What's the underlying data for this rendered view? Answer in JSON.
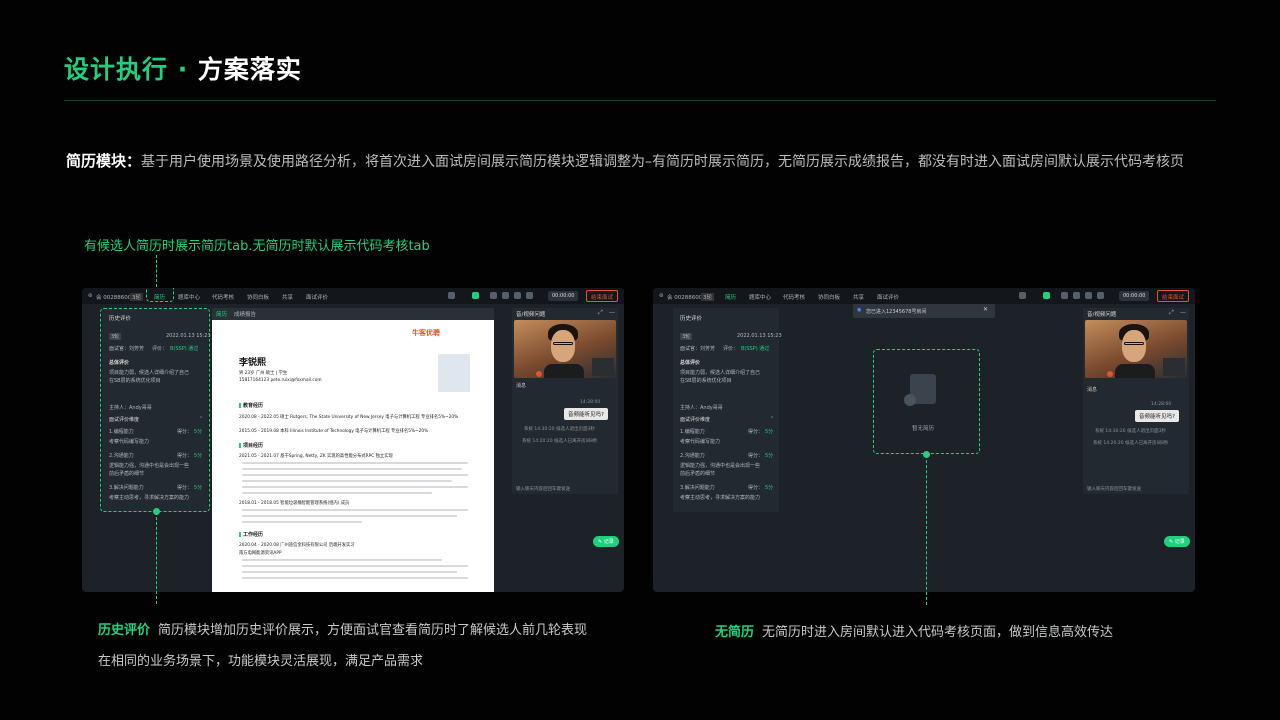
{
  "header": {
    "title_green": "设计执行 · ",
    "title_white": "方案落实"
  },
  "intro": {
    "label": "简历模块：",
    "text": "基于用户使用场景及使用路径分析，将首次进入面试房间展示简历模块逻辑调整为–有简历时展示简历，无简历展示成绩报告，都没有时进入面试房间默认展示代码考核页"
  },
  "annotation_top": "有候选人简历时展示简历tab.无简历时默认展示代码考核tab",
  "annotation_left": {
    "label": "历史评价",
    "line1": "简历模块增加历史评价展示，方便面试官查看简历时了解候选人前几轮表现",
    "line2": "在相同的业务场景下，功能模块灵活展现，满足产品需求"
  },
  "annotation_right": {
    "label": "无简历",
    "text": "无简历时进入房间默认进入代码考核页面，做到信息高效传达"
  },
  "topbar": {
    "room": "会 00288600",
    "tag": "3轮",
    "tabs": [
      "简历",
      "题库中心",
      "代码考核",
      "协同白板",
      "共享",
      "面试评价"
    ],
    "timer": "00:00:00",
    "end": "结束面试"
  },
  "history": {
    "title": "历史评价",
    "round": "3轮",
    "date": "2022.01.13 15:23",
    "interviewer": "面试官：刘芳芳",
    "score_label": "评价：",
    "score": "B(SSP) 通过",
    "summary_title": "总体评价",
    "summary1": "项目能力弱，候选人详细介绍了自己",
    "summary2": "在SB层的系统优化项目",
    "host": "主持人：Andy哥哥",
    "dim_title": "面试评价维度",
    "dims": [
      {
        "name": "1.编程能力",
        "score": "得分：",
        "val": "5分",
        "desc": "考察代码编写能力"
      },
      {
        "name": "2.沟通能力",
        "score": "得分：",
        "val": "5分",
        "desc": "逻辑能力强，沟通中也是会出现一些",
        "desc2": "前后矛盾的细节"
      },
      {
        "name": "3.解决问题能力",
        "score": "得分：",
        "val": "5分",
        "desc": "考察主动思考，寻求解决方案的能力"
      }
    ]
  },
  "resume_tabs": [
    "简历",
    "成绩报告"
  ],
  "resume": {
    "brand": "牛客优聘",
    "name": "李锐熙",
    "info1": "男   23岁   广州   硕士 | 学生",
    "info2": "15817164123    pete.ruixi@foxmail.com",
    "sec_edu": "教育经历",
    "edu1": "2020.08 - 2022.05   硕士   Rutgers, The State University of New Jersey   电子与计算机工程   专业排名5%~20%",
    "edu2": "2015.05 - 2019.08   本科   Illinois Institute of Technology   电子与计算机工程   专业排名5%~20%",
    "sec_proj": "项目经历",
    "proj1": "2021.05 - 2021.07   基于Spring, Netty, ZK 实现的高性能分布式RPC   独立实现",
    "proj2": "2018.01 - 2018.05   智能垃圾桶智能管理系统(组内)   成员",
    "sec_work": "工作经历",
    "work1": "2020.04 - 2020.08   广州途信金科技有限公司   后端开发实习",
    "work2": "南方电网能源资讯APP"
  },
  "chat": {
    "title": "音/视频问题",
    "msg_title": "消息",
    "time": "14:28:00",
    "bubble": "音频能听见吗?",
    "sys1": "系统 14:30:20  候选人退出页面3秒",
    "sys2": "系统 14:20:20  候选人已离开房间8秒",
    "input": "输入聊天内容后回车键发送"
  },
  "record": "记录",
  "toast": "您已进入12345678号房间",
  "empty": "暂无简历"
}
